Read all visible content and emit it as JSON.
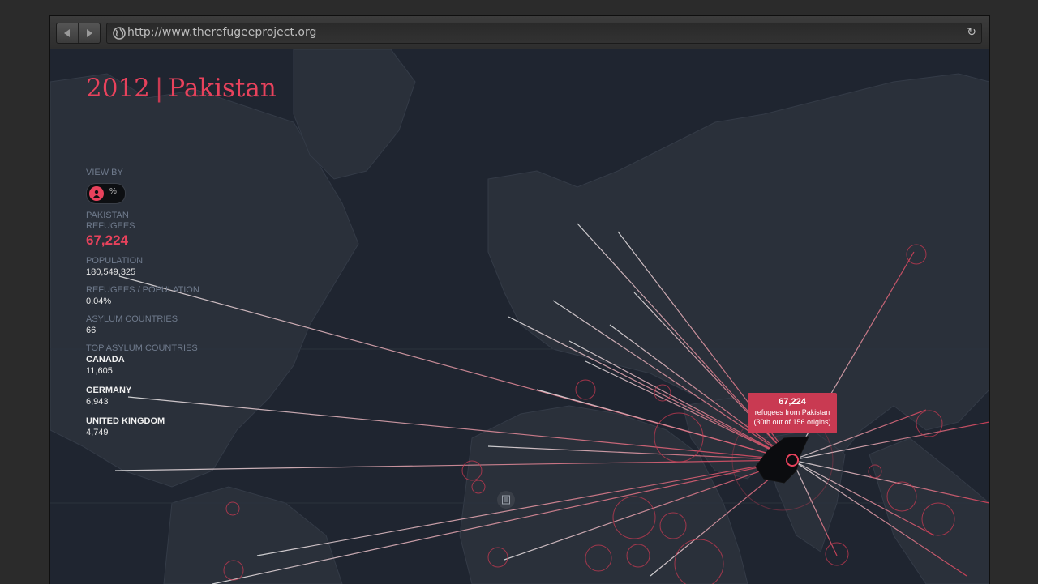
{
  "browser": {
    "url": "http://www.therefugeeproject.org",
    "back_icon": "back-arrow-icon",
    "forward_icon": "forward-arrow-icon",
    "reload_icon": "reload-icon",
    "site_icon": "globe-icon"
  },
  "header": {
    "year": "2012",
    "separator": "|",
    "country": "Pakistan"
  },
  "sidebar": {
    "view_by_label": "VIEW BY",
    "toggle": {
      "left_icon": "person-icon",
      "right_label": "%",
      "selected": "people"
    },
    "refugees_label_line1": "PAKISTAN",
    "refugees_label_line2": "REFUGEES",
    "refugees_value": "67,224",
    "population_label": "POPULATION",
    "population_value": "180,549,325",
    "ratio_label": "REFUGEES / POPULATION",
    "ratio_value": "0.04%",
    "asylum_countries_label": "ASYLUM COUNTRIES",
    "asylum_countries_value": "66",
    "top_asylum_label": "TOP ASYLUM COUNTRIES",
    "top_asylum": [
      {
        "name": "CANADA",
        "value": "11,605"
      },
      {
        "name": "GERMANY",
        "value": "6,943"
      },
      {
        "name": "UNITED KINGDOM",
        "value": "4,749"
      }
    ]
  },
  "tooltip": {
    "count": "67,224",
    "line1": "refugees from Pakistan",
    "line2": "(30th out of 156 origins)"
  },
  "colors": {
    "accent": "#e8425c",
    "map_bg": "#1f2530",
    "land": "#2a303a"
  }
}
